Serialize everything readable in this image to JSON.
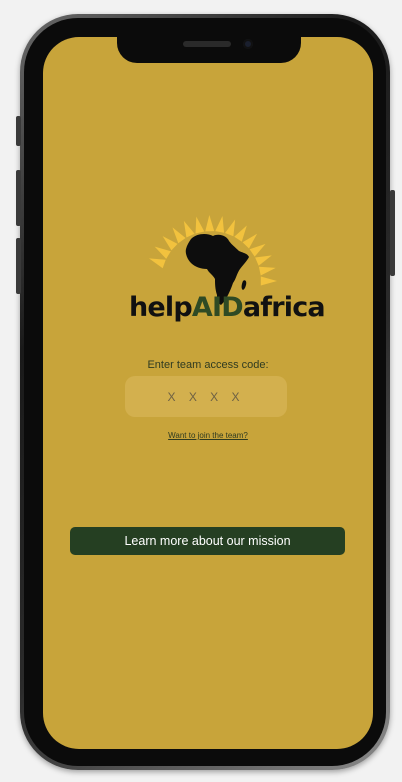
{
  "brand": {
    "name_prefix": "help",
    "name_accent": "AID",
    "name_suffix": "africa"
  },
  "login": {
    "prompt": "Enter team access code:",
    "code_placeholder": "X X X X",
    "join_link": "Want to join the team?"
  },
  "mission_button": {
    "label": "Learn more about our mission"
  },
  "colors": {
    "background": "#c8a43a",
    "input_fill": "#d3b04e",
    "button_fill": "#253f22",
    "accent_text": "#2f4a24",
    "sun_rays": "#f2c23e"
  },
  "icons": {
    "logo": "africa-sun-logo"
  }
}
